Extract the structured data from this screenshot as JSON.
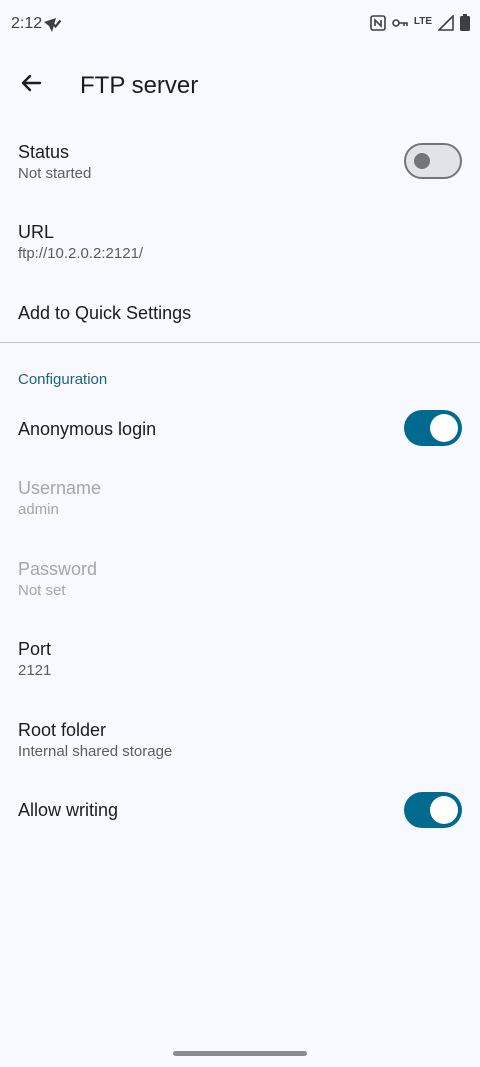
{
  "status_bar": {
    "time": "2:12",
    "network": "LTE"
  },
  "appbar": {
    "title": "FTP server"
  },
  "settings": {
    "status": {
      "title": "Status",
      "subtitle": "Not started",
      "toggle_on": false
    },
    "url": {
      "title": "URL",
      "subtitle": "ftp://10.2.0.2:2121/"
    },
    "quick_settings": {
      "title": "Add to Quick Settings"
    }
  },
  "configuration": {
    "header": "Configuration",
    "anonymous_login": {
      "title": "Anonymous login",
      "toggle_on": true
    },
    "username": {
      "title": "Username",
      "subtitle": "admin",
      "enabled": false
    },
    "password": {
      "title": "Password",
      "subtitle": "Not set",
      "enabled": false
    },
    "port": {
      "title": "Port",
      "subtitle": "2121"
    },
    "root_folder": {
      "title": "Root folder",
      "subtitle": "Internal shared storage"
    },
    "allow_writing": {
      "title": "Allow writing",
      "toggle_on": true
    }
  },
  "colors": {
    "background": "#f8f9fe",
    "accent": "#006a8f",
    "section_header": "#1e6378"
  }
}
